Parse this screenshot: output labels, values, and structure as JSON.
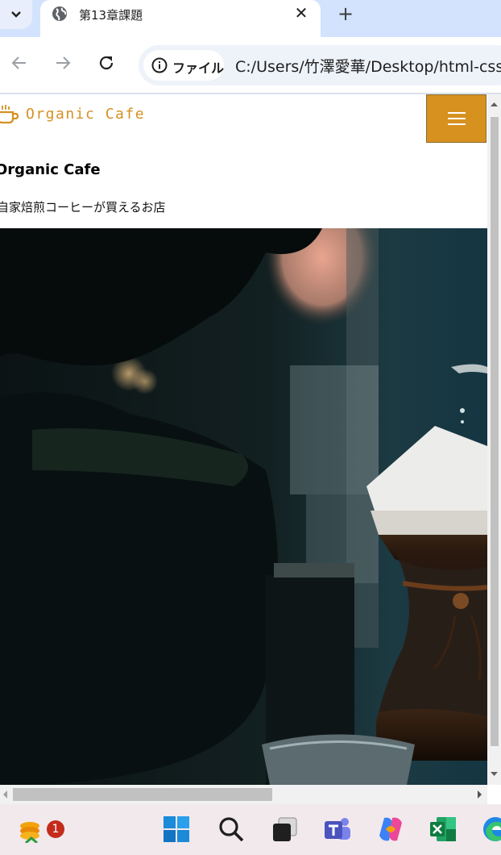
{
  "browser": {
    "tab": {
      "title": "第13章課題"
    },
    "omnibox": {
      "security_chip_label": "ファイル",
      "url": "C:/Users/竹澤愛華/Desktop/html-css"
    }
  },
  "site": {
    "logo_text": "Organic Cafe",
    "title": "Organic Cafe",
    "tagline": "自家焙煎コーヒーが買えるお店",
    "menu_button_color": "#d6911f",
    "logo_color": "#d49123"
  },
  "taskbar": {
    "notification_count": "1",
    "icons": [
      "coins-widget-icon",
      "windows-start-icon",
      "search-icon",
      "task-view-icon",
      "teams-icon",
      "copilot-icon",
      "excel-icon",
      "edge-icon"
    ]
  }
}
